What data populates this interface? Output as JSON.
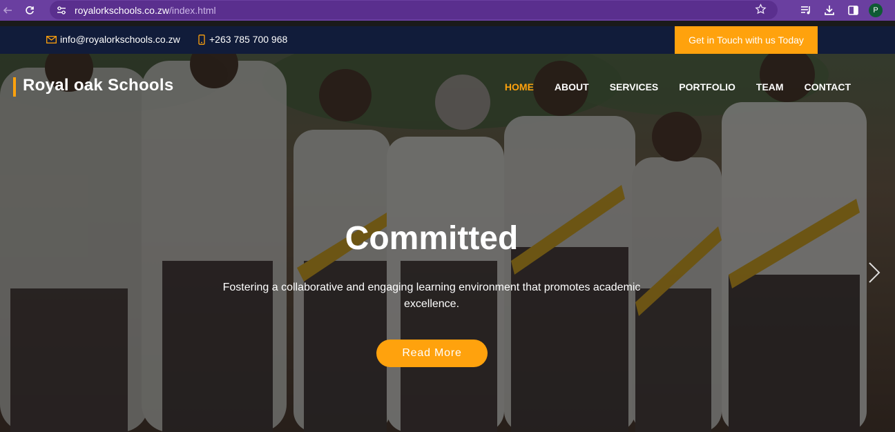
{
  "browser": {
    "url_host": "royalorkschools.co.zw",
    "url_path": "/index.html",
    "profile_initial": "P"
  },
  "topbar": {
    "email": "info@royalorkschools.co.zw",
    "phone": "+263 785 700 968",
    "cta_label": "Get in Touch with us Today"
  },
  "header": {
    "brand": "Royal oak Schools",
    "menu": [
      {
        "label": "HOME",
        "active": true
      },
      {
        "label": "ABOUT"
      },
      {
        "label": "SERVICES"
      },
      {
        "label": "PORTFOLIO"
      },
      {
        "label": "TEAM"
      },
      {
        "label": "CONTACT"
      }
    ]
  },
  "hero": {
    "title": "Committed",
    "subtitle": "Fostering a collaborative and engaging learning environment that promotes academic excellence.",
    "button_label": "Read More"
  },
  "icons": {
    "back": "arrow-left-icon",
    "reload": "reload-icon",
    "site_info": "site-settings-icon",
    "bookmark": "star-icon",
    "media": "media-queue-icon",
    "download": "download-icon",
    "sidebar": "side-panel-icon",
    "email": "envelope-icon",
    "phone": "mobile-phone-icon",
    "next": "chevron-right-icon"
  },
  "colors": {
    "accent": "#ffa20d",
    "browser_bar": "#6a3fa0",
    "topbar": "#111c3a"
  }
}
